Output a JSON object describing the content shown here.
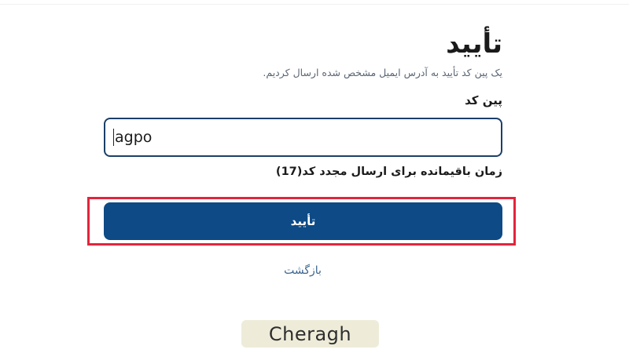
{
  "form": {
    "title": "تأیید",
    "subtitle": "یک پین کد تأیید به آدرس ایمیل مشخص شده ارسال کردیم.",
    "pin_label": "پین کد",
    "pin_value": "agpo",
    "timer_text": "زمان باقیمانده برای ارسال مجدد کد(17)",
    "confirm_label": "تأیید",
    "back_label": "بازگشت"
  },
  "brand": {
    "logo_text": "Cheragh"
  },
  "colors": {
    "primary_button": "#0d4a86",
    "input_border": "#1b3f68",
    "highlight_border": "#e3243c",
    "link": "#3c6590",
    "logo_background": "#eeecd9"
  }
}
